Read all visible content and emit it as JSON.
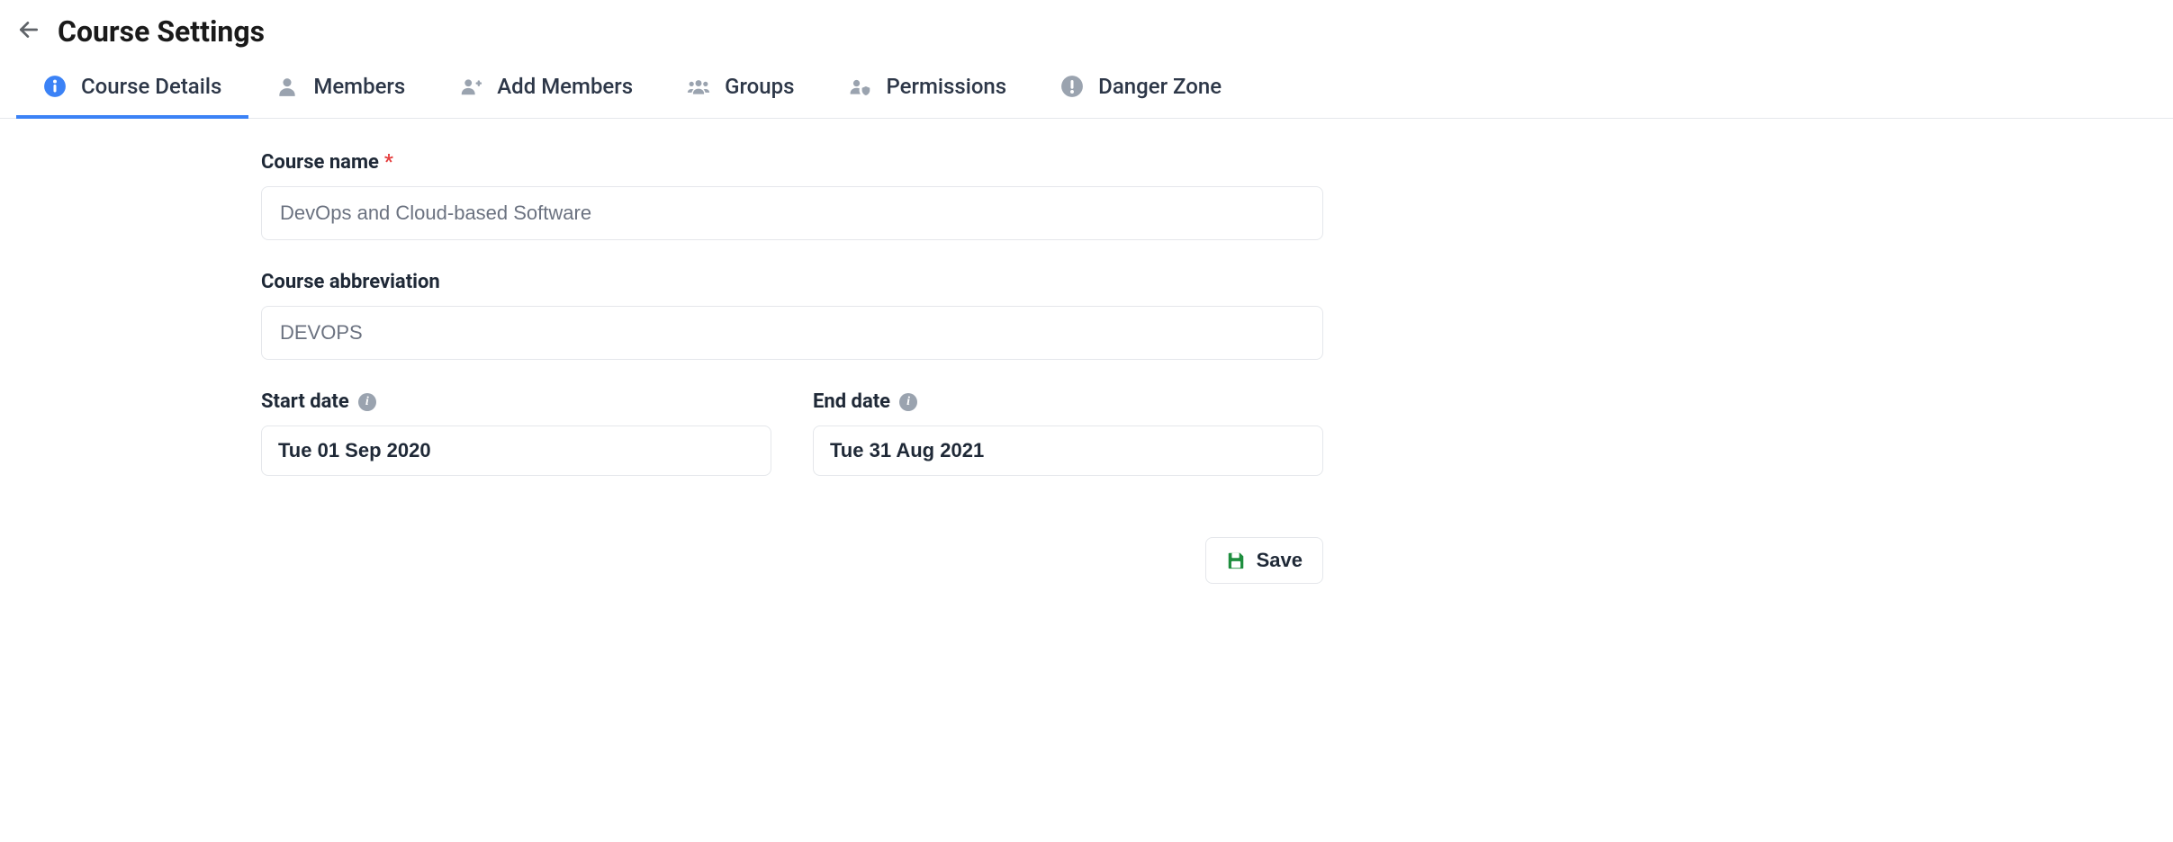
{
  "header": {
    "title": "Course Settings"
  },
  "tabs": [
    {
      "label": "Course Details",
      "icon": "info-circle-icon",
      "active": true
    },
    {
      "label": "Members",
      "icon": "user-icon",
      "active": false
    },
    {
      "label": "Add Members",
      "icon": "user-plus-icon",
      "active": false
    },
    {
      "label": "Groups",
      "icon": "users-icon",
      "active": false
    },
    {
      "label": "Permissions",
      "icon": "user-shield-icon",
      "active": false
    },
    {
      "label": "Danger Zone",
      "icon": "exclamation-circle-icon",
      "active": false
    }
  ],
  "form": {
    "course_name_label": "Course name",
    "course_name_value": "DevOps and Cloud-based Software",
    "course_abbr_label": "Course abbreviation",
    "course_abbr_value": "DEVOPS",
    "start_date_label": "Start date",
    "start_date_value": "Tue 01 Sep 2020",
    "end_date_label": "End date",
    "end_date_value": "Tue 31 Aug 2021",
    "required_marker": "*"
  },
  "buttons": {
    "save_label": "Save"
  }
}
